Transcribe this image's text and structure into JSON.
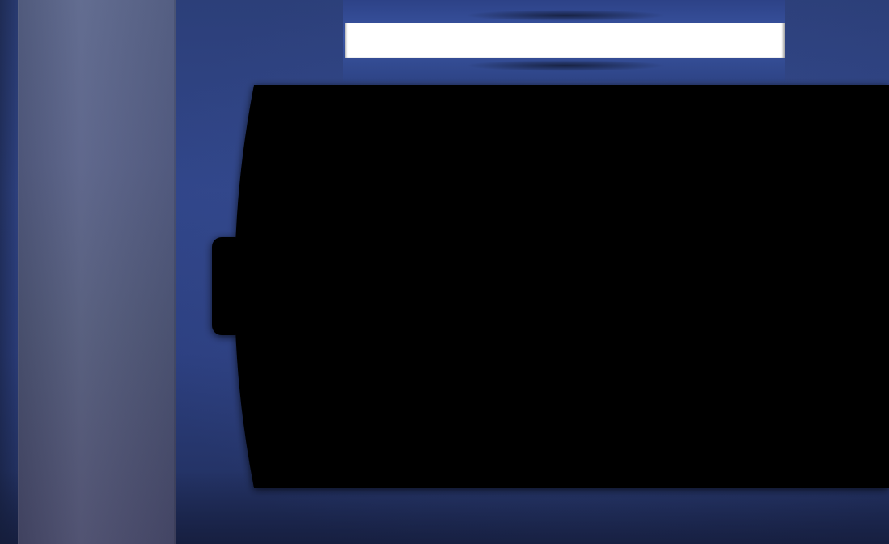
{
  "search": {
    "value": "",
    "placeholder": ""
  },
  "colors": {
    "background": "#31468a",
    "side_panel": "#565f86",
    "top_bar": "#3a55a3",
    "search_field": "#ffffff",
    "screen": "#000000"
  },
  "icons": {
    "screen_tab": "tab-handle-icon"
  }
}
